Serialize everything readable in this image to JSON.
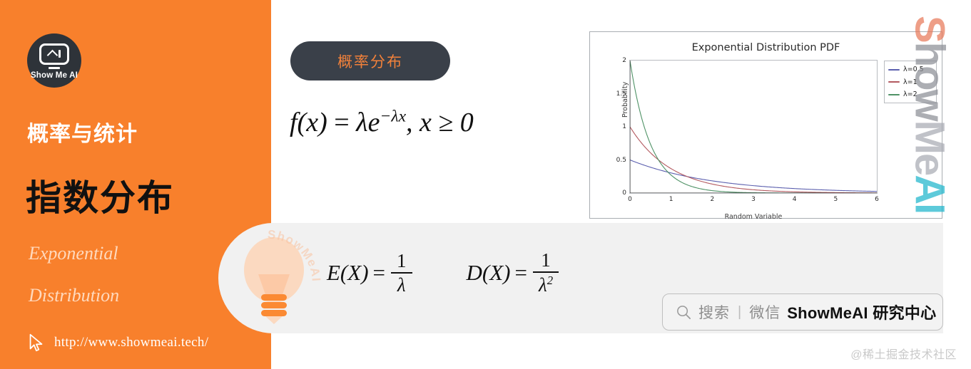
{
  "left_panel": {
    "brand_logo_text": "Show Me AI",
    "subtitle": "概率与统计",
    "title": "指数分布",
    "english_line1": "Exponential",
    "english_line2": "Distribution",
    "url": "http://www.showmeai.tech/",
    "background_color": "#f8802c",
    "title_color": "#111111",
    "subtitle_color": "#ffffff"
  },
  "content": {
    "tag_label": "概率分布",
    "tag_bg_color": "#3a4049",
    "tag_text_color": "#f2813a",
    "pdf_formula": {
      "lhs": "f(x)",
      "eq": "=",
      "rhs_base": "λe",
      "rhs_exponent": "−λx",
      "condition": ", x ≥ 0",
      "plain": "f(x) = λe^(−λx), x ≥ 0"
    }
  },
  "stats_panel": {
    "expectation": {
      "label": "E(X)",
      "eq": "=",
      "numerator": "1",
      "denominator": "λ",
      "plain": "E(X) = 1/λ"
    },
    "variance": {
      "label": "D(X)",
      "eq": "=",
      "numerator": "1",
      "denominator": "λ",
      "denominator_power": "2",
      "plain": "D(X) = 1/λ²"
    },
    "bg_color": "#f1f1f1"
  },
  "search_bar": {
    "placeholder": "搜索",
    "divider": "|",
    "channel": "微信",
    "brand": "ShowMeAI 研究中心"
  },
  "watermarks": {
    "vertical_right": "ShowMeAI",
    "vertical_parts": {
      "s": "S",
      "how": "how",
      "me": "Me",
      "ai": "AI"
    },
    "circular_bulb": "ShowMeAI",
    "corner": "@稀土掘金技术社区"
  },
  "chart_data": {
    "type": "line",
    "title": "Exponential Distribution PDF",
    "xlabel": "Random Variable",
    "ylabel": "Probability",
    "xlim": [
      0,
      6
    ],
    "ylim": [
      0,
      2
    ],
    "xticks": [
      "0",
      "1",
      "2",
      "3",
      "4",
      "5",
      "6"
    ],
    "yticks": [
      "0",
      "0.5",
      "1",
      "1.5",
      "2"
    ],
    "grid": false,
    "legend_position": "upper right (outside axes)",
    "series": [
      {
        "name": "λ=0.5",
        "lambda": 0.5,
        "color": "#5b5fae",
        "x": [
          0,
          0.5,
          1,
          1.5,
          2,
          2.5,
          3,
          3.5,
          4,
          4.5,
          5,
          5.5,
          6
        ],
        "values": [
          0.5,
          0.389,
          0.303,
          0.236,
          0.184,
          0.143,
          0.112,
          0.087,
          0.068,
          0.053,
          0.041,
          0.032,
          0.025
        ]
      },
      {
        "name": "λ=1",
        "lambda": 1,
        "color": "#b3595f",
        "x": [
          0,
          0.5,
          1,
          1.5,
          2,
          2.5,
          3,
          3.5,
          4,
          4.5,
          5,
          5.5,
          6
        ],
        "values": [
          1.0,
          0.607,
          0.368,
          0.223,
          0.135,
          0.082,
          0.05,
          0.03,
          0.018,
          0.011,
          0.007,
          0.004,
          0.002
        ]
      },
      {
        "name": "λ=2",
        "lambda": 2,
        "color": "#4f9266",
        "x": [
          0,
          0.25,
          0.5,
          0.75,
          1,
          1.25,
          1.5,
          1.75,
          2,
          2.5,
          3,
          4,
          5,
          6
        ],
        "values": [
          2.0,
          1.213,
          0.736,
          0.446,
          0.271,
          0.164,
          0.1,
          0.06,
          0.037,
          0.013,
          0.005,
          0.001,
          0.0001,
          0.0
        ]
      }
    ]
  }
}
